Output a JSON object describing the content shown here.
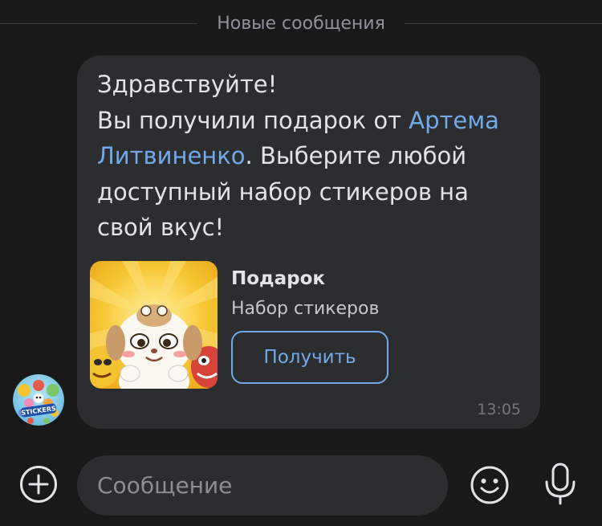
{
  "divider": {
    "label": "Новые сообщения"
  },
  "message": {
    "greeting": "Здравствуйте!",
    "text_before_link": "Вы получили подарок от ",
    "sender_link": "Артема Литвиненко",
    "text_after_link": ". Выберите любой доступный набор стикеров на свой вкус!",
    "time": "13:05"
  },
  "gift": {
    "title": "Подарок",
    "subtitle": "Набор стикеров",
    "button_label": "Получить"
  },
  "avatar": {
    "badge_text": "STICKERS"
  },
  "composer": {
    "placeholder": "Сообщение"
  },
  "icons": {
    "add": "plus-circle-icon",
    "emoji": "smile-icon",
    "mic": "microphone-icon"
  },
  "colors": {
    "background": "#19191a",
    "bubble": "#2c2d2e",
    "accent": "#71aaeb",
    "text": "#e1e3e6",
    "muted": "#8f9399"
  }
}
